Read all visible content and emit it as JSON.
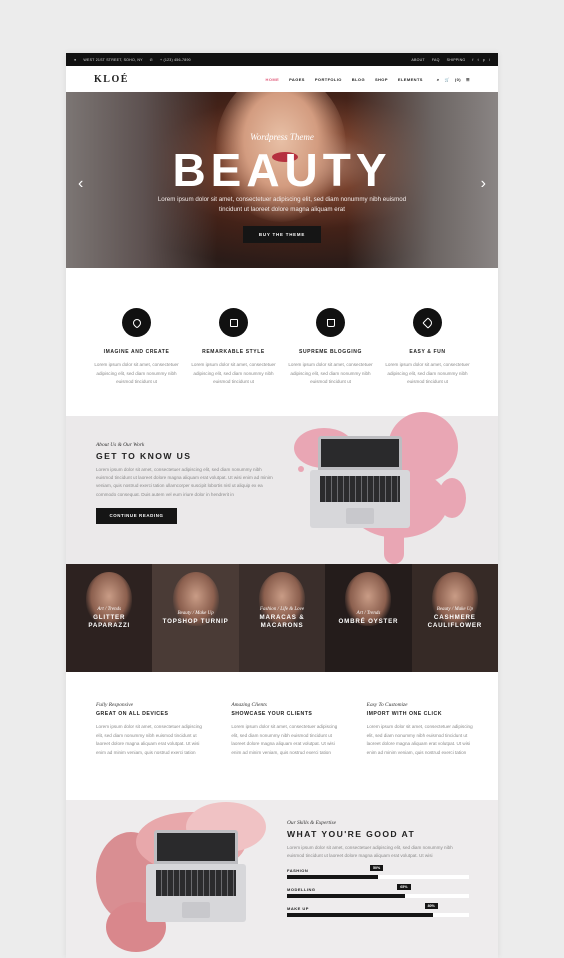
{
  "topbar": {
    "address": "WEST 21ST STREET, SOHO, NY",
    "phone": "+ (123) 456-7890",
    "links": [
      "ABOUT",
      "FAQ",
      "SHIPPING"
    ],
    "social": [
      "f",
      "t",
      "p",
      "i"
    ]
  },
  "nav": {
    "logo": "KLOÉ",
    "items": [
      "HOME",
      "PAGES",
      "PORTFOLIO",
      "BLOG",
      "SHOP",
      "ELEMENTS"
    ],
    "cart": "(0)",
    "active_color": "#e05a7a"
  },
  "hero": {
    "subtitle": "Wordpress Theme",
    "title": "BEAUTY",
    "description": "Lorem ipsum dolor sit amet, consectetuer adipiscing elit, sed diam nonummy nibh euismod tincidunt ut laoreet dolore magna aliquam erat",
    "button": "BUY THE THEME"
  },
  "features": [
    {
      "title": "IMAGINE AND CREATE",
      "icon": "heart-icon",
      "text": "Lorem ipsum dolor sit amet, consectetuer adipiscing elit, sed diam nonummy nibh euismod tincidunt ut"
    },
    {
      "title": "REMARKABLE STYLE",
      "icon": "gift-icon",
      "text": "Lorem ipsum dolor sit amet, consectetuer adipiscing elit, sed diam nonummy nibh euismod tincidunt ut"
    },
    {
      "title": "SUPREME BLOGGING",
      "icon": "bag-icon",
      "text": "Lorem ipsum dolor sit amet, consectetuer adipiscing elit, sed diam nonummy nibh euismod tincidunt ut"
    },
    {
      "title": "EASY & FUN",
      "icon": "tag-icon",
      "text": "Lorem ipsum dolor sit amet, consectetuer adipiscing elit, sed diam nonummy nibh euismod tincidunt ut"
    }
  ],
  "about": {
    "kicker": "About Us & Our Work",
    "title": "GET TO KNOW US",
    "text": "Lorem ipsum dolor sit amet, consectetuer adipiscing elit, sed diam nonummy nibh euismod tincidunt ut laoreet dolore magna aliquam erat volutpat. Ut wisi enim ad minim veniam, quis nostrud exerci tation ullamcorper suscipit lobortis nisl ut aliquip ex ea commodo consequat. Duis autem vel eum iriure dolor in hendrerit in",
    "button": "CONTINUE READING"
  },
  "posts": [
    {
      "category": "Art / Trends",
      "title": "GLITTER PAPARAZZI"
    },
    {
      "category": "Beauty / Make Up",
      "title": "TOPSHOP TURNIP"
    },
    {
      "category": "Fashion / Life & Love",
      "title": "MARACAS & MACARONS"
    },
    {
      "category": "Art / Trends",
      "title": "OMBRÉ OYSTER"
    },
    {
      "category": "Beauty / Make Up",
      "title": "CASHMERE CAULIFLOWER"
    }
  ],
  "advantages": [
    {
      "kicker": "Fully Responsive",
      "title": "GREAT ON ALL DEVICES",
      "text": "Lorem ipsum dolor sit amet, consectetuer adipiscing elit, sed diam nonummy nibh euismod tincidunt ut laoreet dolore magna aliquam erat volutpat. Ut wisi enim ad minim veniam, quis nostrud exerci tation"
    },
    {
      "kicker": "Amazing Clients",
      "title": "SHOWCASE YOUR CLIENTS",
      "text": "Lorem ipsum dolor sit amet, consectetuer adipiscing elit, sed diam nonummy nibh euismod tincidunt ut laoreet dolore magna aliquam erat volutpat. Ut wisi enim ad minim veniam, quis nostrud exerci tation"
    },
    {
      "kicker": "Easy To Customize",
      "title": "IMPORT WITH ONE CLICK",
      "text": "Lorem ipsum dolor sit amet, consectetuer adipiscing elit, sed diam nonummy nibh euismod tincidunt ut laoreet dolore magna aliquam erat volutpat. Ut wisi enim ad minim veniam, quis nostrud exerci tation"
    }
  ],
  "skills": {
    "kicker": "Our Skills & Expertise",
    "title": "WHAT YOU'RE GOOD AT",
    "text": "Lorem ipsum dolor sit amet, consectetuer adipiscing elit, sed diam nonummy nibh euismod tincidunt ut laoreet dolore magna aliquam erat volutpat. Ut wisi",
    "bars": [
      {
        "label": "FASHION",
        "percent": 50,
        "value_label": "50%"
      },
      {
        "label": "MODELLING",
        "percent": 65,
        "value_label": "65%"
      },
      {
        "label": "MAKE UP",
        "percent": 80,
        "value_label": "80%"
      }
    ]
  }
}
